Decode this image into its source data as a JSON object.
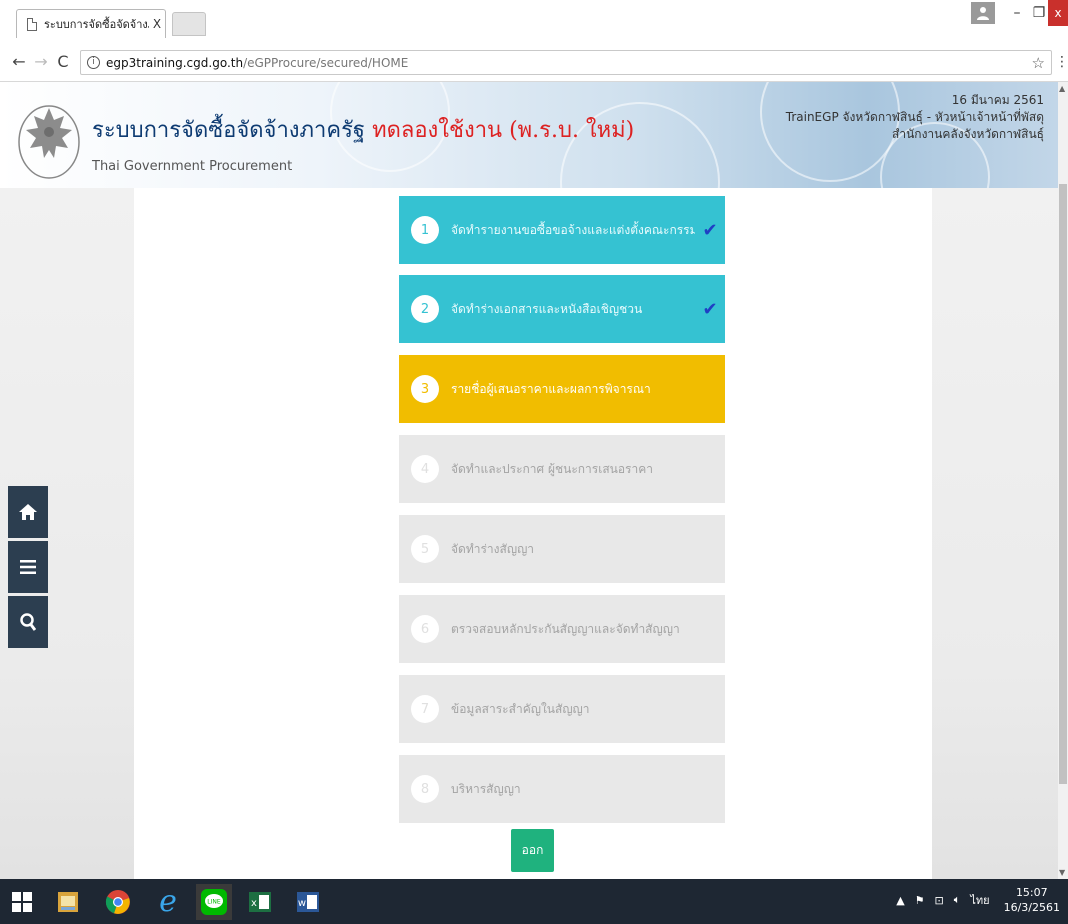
{
  "browser": {
    "tab_title": "ระบบการจัดซื้อจัดจ้างภาครัฐ",
    "tab_close": "X",
    "url_host": "egp3training.cgd.go.th",
    "url_path": "/eGPProcure/secured/HOME"
  },
  "header": {
    "title_main": "ระบบการจัดซื้อจัดจ้างภาครัฐ ",
    "title_trial": "ทดลองใช้งาน (พ.ร.บ. ใหม่)",
    "subtitle": "Thai Government Procurement",
    "date": "16 มีนาคม 2561",
    "user_line": "TrainEGP จังหวัดกาฬสินธุ์ - หัวหน้าเจ้าหน้าที่พัสดุ",
    "org_line": "สำนักงานคลังจังหวัดกาฬสินธุ์"
  },
  "steps": [
    {
      "num": "1",
      "label": "จัดทำรายงานขอซื้อขอจ้างและแต่งตั้งคณะกรรมการ",
      "state": "done",
      "check": "✔"
    },
    {
      "num": "2",
      "label": "จัดทำร่างเอกสารและหนังสือเชิญชวน",
      "state": "done",
      "check": "✔"
    },
    {
      "num": "3",
      "label": "รายชื่อผู้เสนอราคาและผลการพิจารณา",
      "state": "active",
      "check": ""
    },
    {
      "num": "4",
      "label": "จัดทำและประกาศ ผู้ชนะการเสนอราคา",
      "state": "pending",
      "check": ""
    },
    {
      "num": "5",
      "label": "จัดทำร่างสัญญา",
      "state": "pending",
      "check": ""
    },
    {
      "num": "6",
      "label": "ตรวจสอบหลักประกันสัญญาและจัดทำสัญญา",
      "state": "pending",
      "check": ""
    },
    {
      "num": "7",
      "label": "ข้อมูลสาระสำคัญในสัญญา",
      "state": "pending",
      "check": ""
    },
    {
      "num": "8",
      "label": "บริหารสัญญา",
      "state": "pending",
      "check": ""
    }
  ],
  "exit_label": "ออก",
  "colors": {
    "done": "#35c2d2",
    "active": "#f1bd00",
    "pending": "#e8e8e8",
    "exit": "#1fb27e",
    "side_tools": "#2c3e50"
  },
  "side_tools": [
    "home-icon",
    "menu-icon",
    "search-icon"
  ],
  "taskbar": {
    "apps": [
      "windows-start-icon",
      "file-explorer-icon",
      "chrome-icon",
      "internet-explorer-icon",
      "line-icon",
      "excel-icon",
      "word-icon"
    ],
    "lang": "ไทย",
    "time": "15:07",
    "date": "16/3/2561"
  }
}
